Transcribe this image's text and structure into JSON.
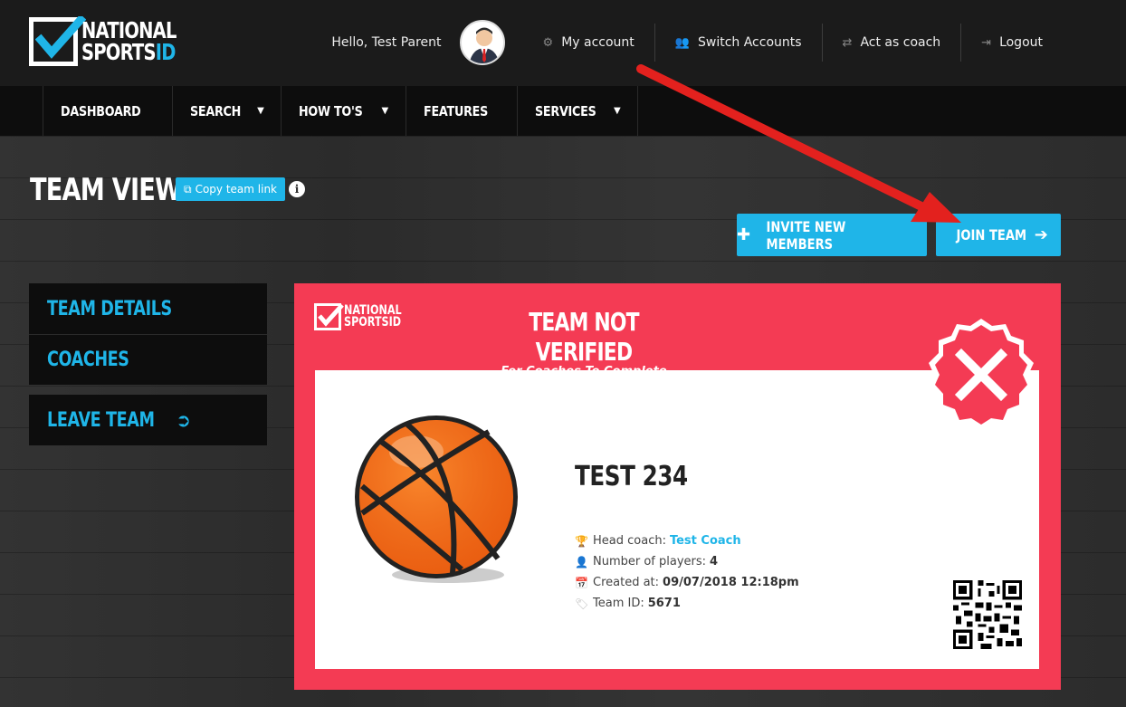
{
  "brand": {
    "line1": "NATIONAL",
    "line2a": "SPORTS",
    "line2b": "ID"
  },
  "header": {
    "greeting": "Hello, Test Parent",
    "links": [
      {
        "label": "My account",
        "icon": "gear-icon"
      },
      {
        "label": "Switch Accounts",
        "icon": "users-icon"
      },
      {
        "label": "Act as coach",
        "icon": "swap-icon"
      },
      {
        "label": "Logout",
        "icon": "logout-icon"
      }
    ]
  },
  "nav": {
    "items": [
      {
        "label": "DASHBOARD",
        "dropdown": false
      },
      {
        "label": "SEARCH",
        "dropdown": true
      },
      {
        "label": "HOW TO'S",
        "dropdown": true
      },
      {
        "label": "FEATURES",
        "dropdown": false
      },
      {
        "label": "SERVICES",
        "dropdown": true
      }
    ]
  },
  "page": {
    "title": "TEAM VIEW",
    "copy_link": "Copy team link",
    "invite_button": "INVITE NEW MEMBERS",
    "join_button": "JOIN TEAM"
  },
  "sidebar": {
    "items": [
      {
        "label": "TEAM DETAILS"
      },
      {
        "label": "COACHES"
      }
    ],
    "leave": "LEAVE TEAM"
  },
  "card": {
    "logo_line1": "NATIONAL",
    "logo_line2": "SPORTSID",
    "status": "TEAM NOT VERIFIED",
    "status_sub": "For Coaches To Complete",
    "team_name": "TEST 234",
    "head_coach_label": "Head coach:",
    "head_coach": "Test Coach",
    "players_label": "Number of players:",
    "players": "4",
    "created_label": "Created at:",
    "created": "09/07/2018 12:18pm",
    "team_id_label": "Team ID:",
    "team_id": "5671"
  },
  "colors": {
    "accent": "#1fb5e8",
    "card_red": "#f43b54",
    "header_bg": "#1b1b1b",
    "nav_bg": "#0d0d0d"
  }
}
